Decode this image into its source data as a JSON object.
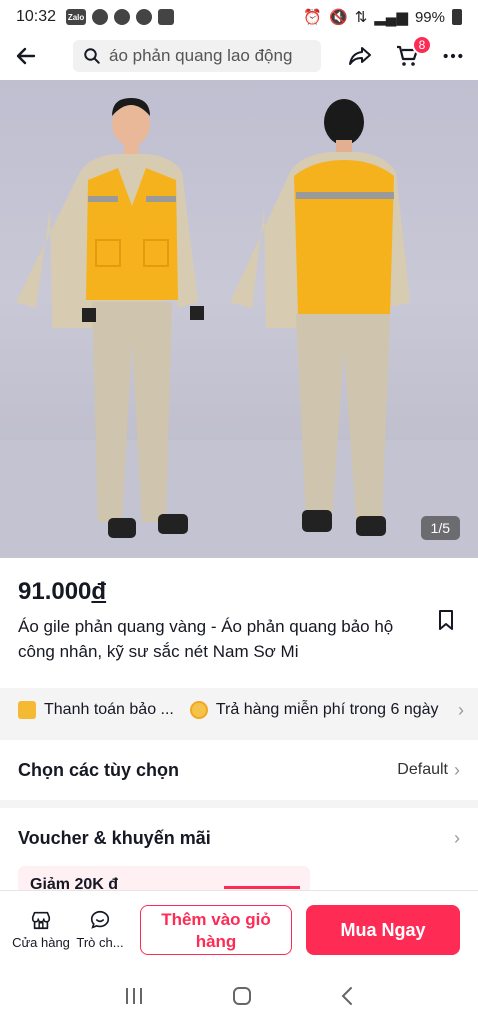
{
  "status_bar": {
    "time": "10:32",
    "app_badge": "Zalo",
    "battery": "99%"
  },
  "search": {
    "query": "áo phản quang lao động"
  },
  "cart": {
    "count": "8"
  },
  "gallery": {
    "counter": "1/5"
  },
  "product": {
    "price": "91.000",
    "currency": "đ",
    "title": "Áo gile phản quang vàng - Áo phản quang bảo hộ công nhân, kỹ sư sắc nét Nam Sơ Mi"
  },
  "services": [
    {
      "label": "Thanh toán bảo ...",
      "icon": "card-icon"
    },
    {
      "label": "Trả hàng miễn phí trong 6 ngày",
      "icon": "coin-icon"
    }
  ],
  "options": {
    "label": "Chọn các tùy chọn",
    "value": "Default"
  },
  "voucher": {
    "label": "Voucher & khuyến mãi",
    "card_text": "Giảm 20K đ"
  },
  "bottom_bar": {
    "shop_label": "Cửa hàng",
    "chat_label": "Trò ch...",
    "add_to_cart": "Thêm vào giỏ hàng",
    "buy_now": "Mua Ngay"
  },
  "colors": {
    "accent": "#fe2c55",
    "vest": "#f6b21c",
    "pants": "#cfc4ad"
  }
}
